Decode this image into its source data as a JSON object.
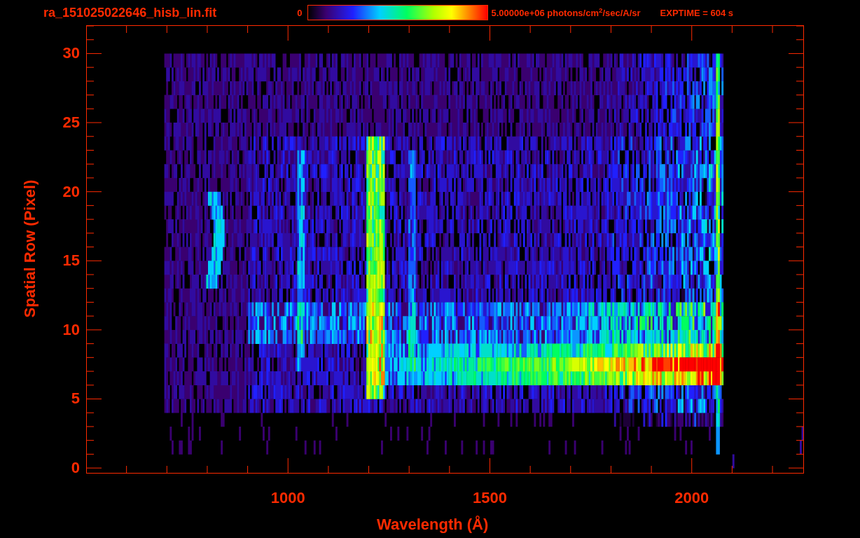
{
  "header": {
    "title": "ra_151025022646_hisb_lin.fit",
    "scale_min": "0",
    "scale_max": "5.00000e+06 photons/cm$^{2}$/sec/A/sr",
    "exptime": "EXPTIME = 604 s"
  },
  "plot": {
    "xlabel": "Wavelength (Å)",
    "ylabel": "Spatial Row (Pixel)",
    "xticks": [
      "1000",
      "1500",
      "2000"
    ],
    "yticks": [
      "30",
      "25",
      "20",
      "15",
      "10",
      "5",
      "0"
    ]
  }
}
